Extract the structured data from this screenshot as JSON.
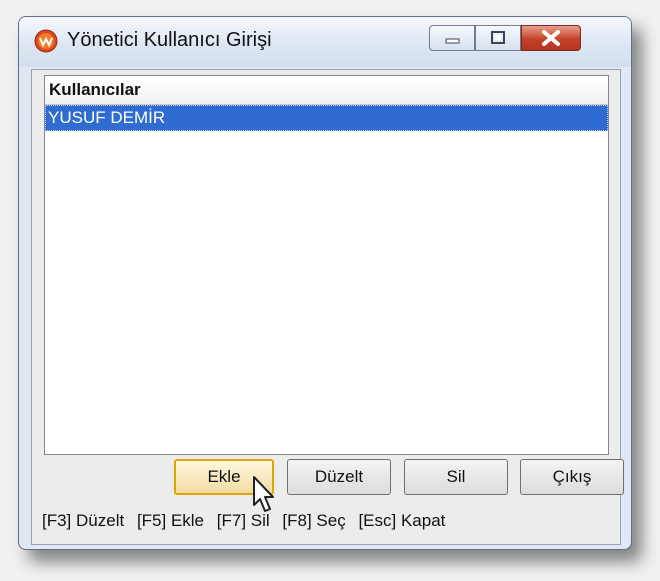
{
  "window": {
    "title": "Yönetici Kullanıcı Girişi"
  },
  "list": {
    "header": "Kullanıcılar",
    "items": [
      {
        "label": "YUSUF DEMİR",
        "selected": true
      }
    ]
  },
  "buttons": {
    "add": "Ekle",
    "edit": "Düzelt",
    "delete": "Sil",
    "exit": "Çıkış"
  },
  "shortcuts": [
    "[F3] Düzelt",
    "[F5] Ekle",
    "[F7] Sil",
    "[F8] Seç",
    "[Esc] Kapat"
  ],
  "icons": {
    "app": "app-logo-icon",
    "minimize": "minimize-icon",
    "maximize": "maximize-icon",
    "close": "close-icon",
    "cursor": "mouse-pointer-icon"
  },
  "colors": {
    "selection": "#2f6bd0",
    "close_button": "#c5412a",
    "focused_button_border": "#e2a400"
  }
}
